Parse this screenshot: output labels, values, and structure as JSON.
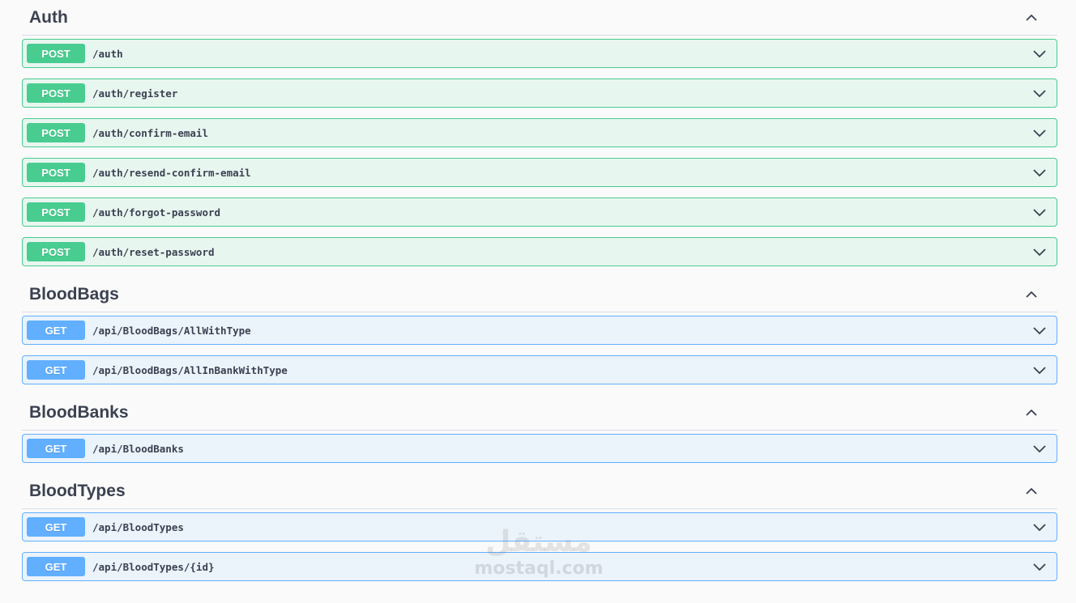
{
  "sections": [
    {
      "title": "Auth",
      "operations": [
        {
          "method": "POST",
          "path": "/auth"
        },
        {
          "method": "POST",
          "path": "/auth/register"
        },
        {
          "method": "POST",
          "path": "/auth/confirm-email"
        },
        {
          "method": "POST",
          "path": "/auth/resend-confirm-email"
        },
        {
          "method": "POST",
          "path": "/auth/forgot-password"
        },
        {
          "method": "POST",
          "path": "/auth/reset-password"
        }
      ]
    },
    {
      "title": "BloodBags",
      "operations": [
        {
          "method": "GET",
          "path": "/api/BloodBags/AllWithType"
        },
        {
          "method": "GET",
          "path": "/api/BloodBags/AllInBankWithType"
        }
      ]
    },
    {
      "title": "BloodBanks",
      "operations": [
        {
          "method": "GET",
          "path": "/api/BloodBanks"
        }
      ]
    },
    {
      "title": "BloodTypes",
      "operations": [
        {
          "method": "GET",
          "path": "/api/BloodTypes"
        },
        {
          "method": "GET",
          "path": "/api/BloodTypes/{id}"
        }
      ]
    }
  ],
  "watermark": {
    "arabic": "مستقل",
    "latin": "mostaql.com"
  },
  "colors": {
    "post": "#49cc90",
    "get": "#61affe",
    "text": "#3b4151"
  },
  "icons": {
    "section_toggle": "chevron-up-icon",
    "operation_toggle": "chevron-down-icon"
  }
}
